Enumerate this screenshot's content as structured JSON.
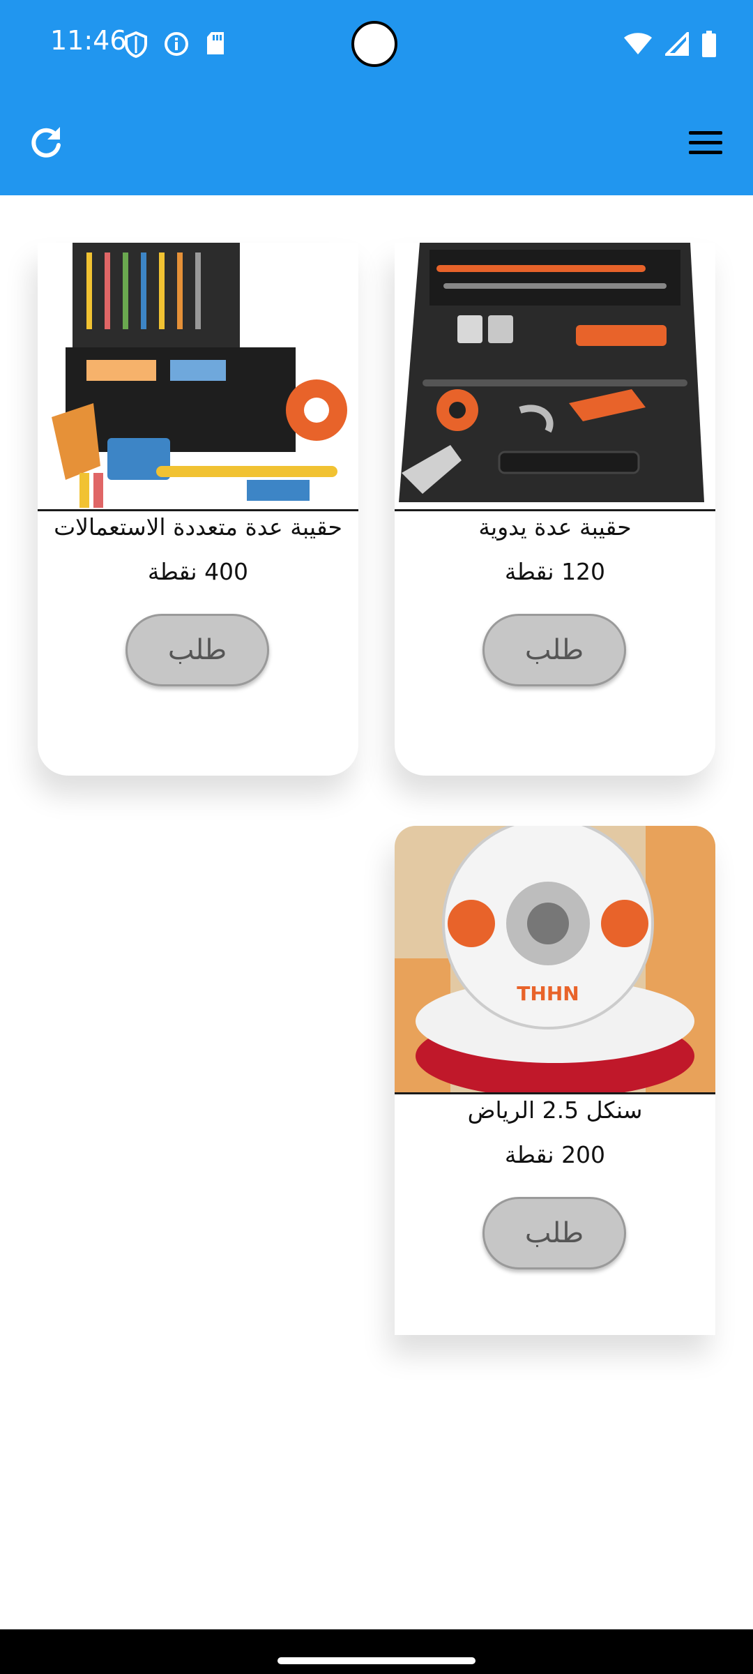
{
  "status_bar": {
    "time": "11:46",
    "left_icons": [
      "shield-icon",
      "info-icon",
      "sd-card-icon"
    ],
    "right_icons": [
      "wifi-icon",
      "signal-icon",
      "battery-icon"
    ]
  },
  "app_bar": {
    "refresh_icon": "refresh-icon",
    "menu_icon": "hamburger-menu-icon",
    "color": "#2196ef"
  },
  "products": [
    {
      "name": "حقيبة عدة يدوية",
      "price": "120 نقطة",
      "button_label": "طلب",
      "image": "hand-tool-case"
    },
    {
      "name": "حقيبة عدة متعددة الاستعمالات",
      "price": "400 نقطة",
      "button_label": "طلب",
      "image": "multi-purpose-tool-case"
    },
    {
      "name": "سنكل 2.5 الرياض",
      "price": "200 نقطة",
      "button_label": "طلب",
      "image": "thhn-wire-spool"
    }
  ]
}
